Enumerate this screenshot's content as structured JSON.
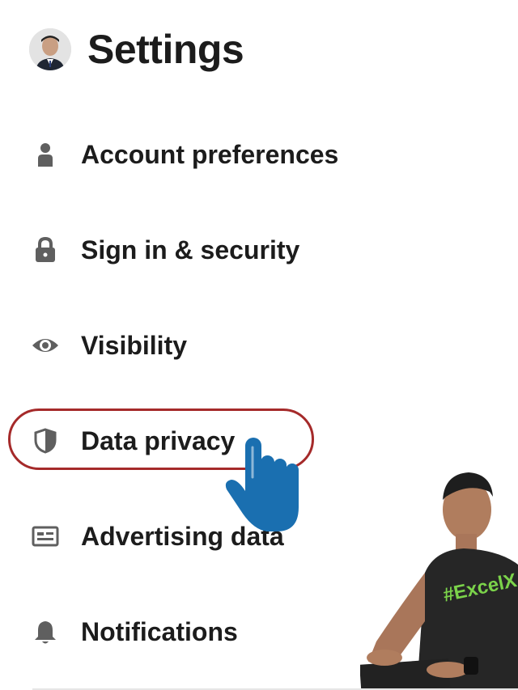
{
  "header": {
    "title": "Settings",
    "avatar_icon": "user-avatar"
  },
  "menu": {
    "items": [
      {
        "label": "Account preferences",
        "icon": "person-icon"
      },
      {
        "label": "Sign in & security",
        "icon": "lock-icon"
      },
      {
        "label": "Visibility",
        "icon": "eye-icon"
      },
      {
        "label": "Data privacy",
        "icon": "shield-icon",
        "highlighted": true
      },
      {
        "label": "Advertising data",
        "icon": "ad-card-icon"
      },
      {
        "label": "Notifications",
        "icon": "bell-icon"
      }
    ]
  },
  "overlay": {
    "presenter_shirt_text": "#ExcelX"
  },
  "colors": {
    "text": "#1c1c1c",
    "icon": "#5f5f5f",
    "highlight_ring": "#a52a2a",
    "hand_cursor": "#1a6fb0"
  }
}
